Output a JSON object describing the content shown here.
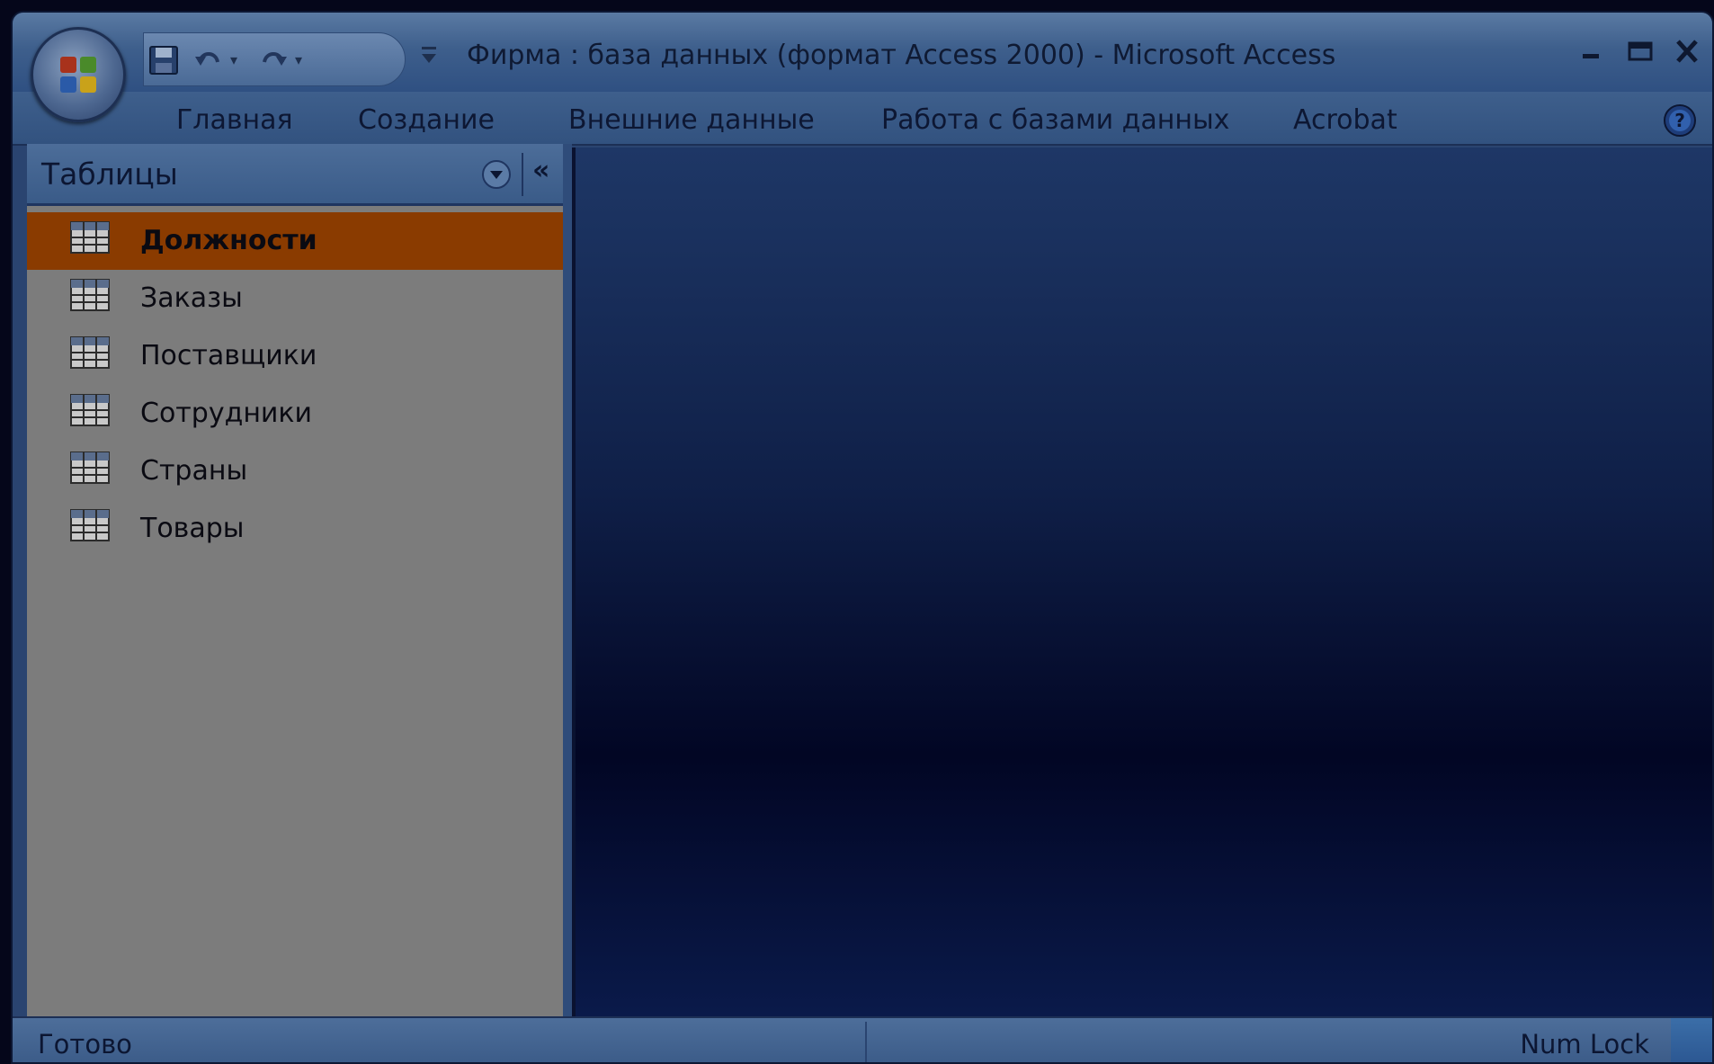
{
  "window": {
    "title": "Фирма : база данных (формат Access 2000)  -  Microsoft Access"
  },
  "ribbon": {
    "tabs": [
      {
        "label": "Главная"
      },
      {
        "label": "Создание"
      },
      {
        "label": "Внешние данные"
      },
      {
        "label": "Работа с базами данных"
      },
      {
        "label": "Acrobat"
      }
    ]
  },
  "nav_pane": {
    "title": "Таблицы",
    "collapse_glyph": "«",
    "items": [
      {
        "label": "Должности",
        "selected": true,
        "icon": "table-icon"
      },
      {
        "label": "Заказы",
        "selected": false,
        "icon": "table-icon"
      },
      {
        "label": "Поставщики",
        "selected": false,
        "icon": "table-icon"
      },
      {
        "label": "Сотрудники",
        "selected": false,
        "icon": "table-icon"
      },
      {
        "label": "Страны",
        "selected": false,
        "icon": "table-icon"
      },
      {
        "label": "Товары",
        "selected": false,
        "icon": "table-icon"
      }
    ]
  },
  "status": {
    "left": "Готово",
    "right": "Num Lock"
  },
  "colors": {
    "selected_item": "#8a3b00",
    "nav_background": "#7c7c7c",
    "frame": "#2a4470"
  }
}
